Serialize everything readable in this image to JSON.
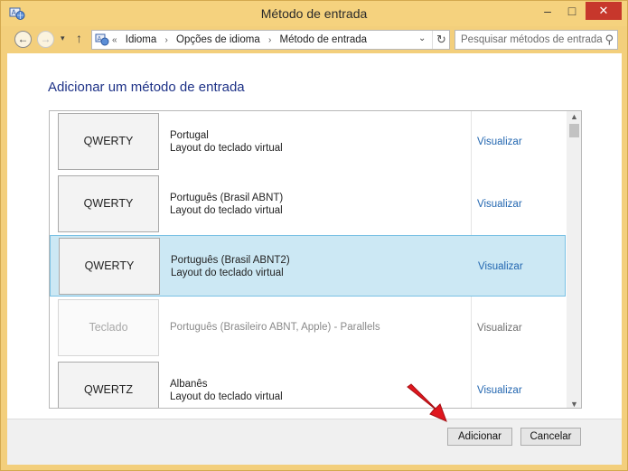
{
  "window": {
    "title": "Método de entrada",
    "minimize_glyph": "‒",
    "maximize_glyph": "□",
    "close_glyph": "✕"
  },
  "nav": {
    "back_glyph": "←",
    "forward_glyph": "→",
    "recent_glyph": "▾",
    "up_glyph": "↑",
    "breadcrumb": [
      "Idioma",
      "Opções de idioma",
      "Método de entrada"
    ],
    "breadcrumb_prefix": "«",
    "breadcrumb_sep": "›",
    "address_dropdown_glyph": "⌄",
    "refresh_glyph": "↻",
    "search_placeholder": "Pesquisar métodos de entrada",
    "search_glyph": "⚲"
  },
  "main": {
    "heading": "Adicionar um método de entrada",
    "link_label": "Visualizar",
    "scroll_up_glyph": "▲",
    "scroll_down_glyph": "▼",
    "items": [
      {
        "layout": "QWERTY",
        "name": "Portugal",
        "desc": "Layout do teclado virtual",
        "state": "normal"
      },
      {
        "layout": "QWERTY",
        "name": "Português (Brasil ABNT)",
        "desc": "Layout do teclado virtual",
        "state": "normal"
      },
      {
        "layout": "QWERTY",
        "name": "Português (Brasil ABNT2)",
        "desc": "Layout do teclado virtual",
        "state": "selected"
      },
      {
        "layout": "Teclado",
        "name": "Português (Brasileiro ABNT, Apple) - Parallels",
        "desc": "",
        "state": "disabled"
      },
      {
        "layout": "QWERTZ",
        "name": "Albanês",
        "desc": "Layout do teclado virtual",
        "state": "normal"
      }
    ]
  },
  "footer": {
    "add_label": "Adicionar",
    "cancel_label": "Cancelar"
  },
  "colors": {
    "window_frame": "#f3cf7c",
    "heading": "#1e3287",
    "link": "#2266b0",
    "selection": "#cce8f4",
    "selection_border": "#7ac1e4",
    "close_button": "#c7372c",
    "annotation_arrow": "#e0161e"
  }
}
